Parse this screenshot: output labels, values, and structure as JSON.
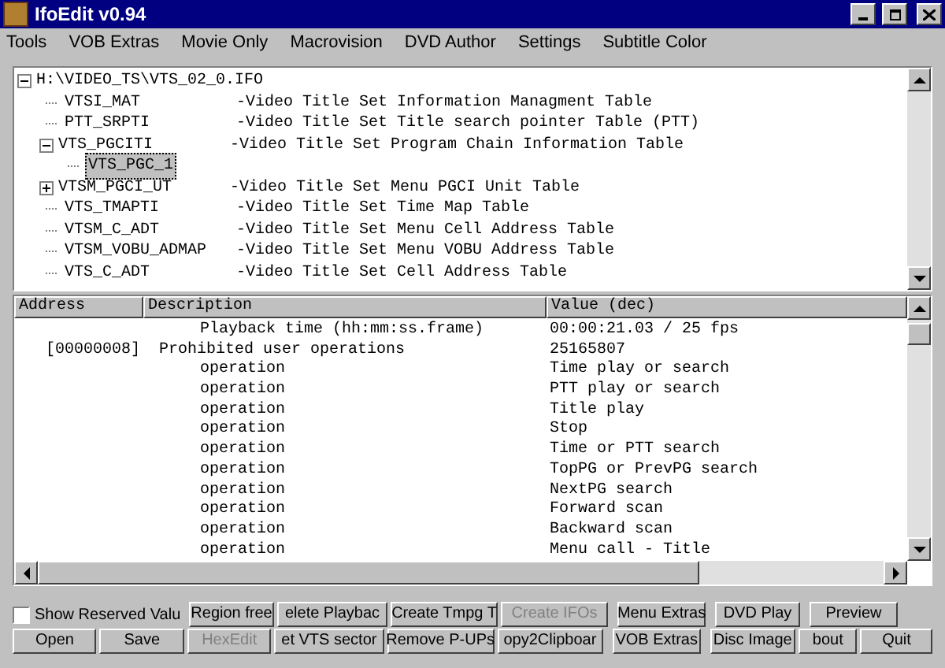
{
  "window": {
    "title": "IfoEdit v0.94"
  },
  "menu": [
    "Tools",
    "VOB Extras",
    "Movie Only",
    "Macrovision",
    "DVD Author",
    "Settings",
    "Subtitle Color"
  ],
  "tree": {
    "name": "H:\\VIDEO_TS\\VTS_02_0.IFO",
    "expanded": true,
    "selected": false,
    "children": [
      {
        "name": "VTSI_MAT",
        "description": "-Video Title Set Information Managment Table",
        "selected": false
      },
      {
        "name": "PTT_SRPTI",
        "description": "-Video Title Set Title search pointer Table (PTT)",
        "selected": false
      },
      {
        "name": "VTS_PGCITI",
        "description": "-Video Title Set Program Chain Information Table",
        "expanded": true,
        "selected": false,
        "children": [
          {
            "name": "VTS_PGC_1",
            "selected": true
          }
        ]
      },
      {
        "name": "VTSM_PGCI_UT",
        "description": "-Video Title Set Menu PGCI Unit Table",
        "expanded": false,
        "selected": false
      },
      {
        "name": "VTS_TMAPTI",
        "description": "-Video Title Set Time Map Table",
        "selected": false
      },
      {
        "name": "VTSM_C_ADT",
        "description": "-Video Title Set Menu Cell Address Table",
        "selected": false
      },
      {
        "name": "VTSM_VOBU_ADMAP",
        "description": "-Video Title Set Menu VOBU Address Table",
        "selected": false
      },
      {
        "name": "VTS_C_ADT",
        "description": "-Video Title Set Cell Address Table",
        "selected": false
      }
    ]
  },
  "table": {
    "columns": [
      "Address",
      "Description",
      "Value (dec)"
    ],
    "rows": [
      {
        "kind": "detail",
        "description": "Playback time (hh:mm:ss.frame)",
        "value": "00:00:21.03 / 25 fps"
      },
      {
        "kind": "entry",
        "address": "[00000008]",
        "description": "Prohibited user operations",
        "value": "25165807"
      },
      {
        "kind": "detail",
        "description": "operation",
        "value": "Time play or search"
      },
      {
        "kind": "detail",
        "description": "operation",
        "value": "PTT play or search"
      },
      {
        "kind": "detail",
        "description": "operation",
        "value": "Title play"
      },
      {
        "kind": "detail",
        "description": "operation",
        "value": "Stop"
      },
      {
        "kind": "detail",
        "description": "operation",
        "value": "Time or PTT search"
      },
      {
        "kind": "detail",
        "description": "operation",
        "value": "TopPG or PrevPG search"
      },
      {
        "kind": "detail",
        "description": "operation",
        "value": "NextPG search"
      },
      {
        "kind": "detail",
        "description": "operation",
        "value": "Forward scan"
      },
      {
        "kind": "detail",
        "description": "operation",
        "value": "Backward scan"
      },
      {
        "kind": "detail",
        "description": "operation",
        "value": "Menu call - Title"
      }
    ]
  },
  "show_reserved": {
    "label": "Show Reserved Valu",
    "checked": false
  },
  "buttons_row_1": [
    {
      "label": "Region free",
      "disabled": false
    },
    {
      "label": "elete Playbac",
      "disabled": false
    },
    {
      "label": "Create Tmpg T",
      "disabled": false
    },
    {
      "label": "Create IFOs",
      "disabled": true
    },
    {
      "label": "Menu Extras",
      "disabled": false
    },
    {
      "label": "DVD Play",
      "disabled": false
    },
    {
      "label": "Preview",
      "disabled": false
    }
  ],
  "buttons_row_2": [
    {
      "label": "Open",
      "disabled": false
    },
    {
      "label": "Save",
      "disabled": false
    },
    {
      "label": "HexEdit",
      "disabled": true
    },
    {
      "label": "et VTS sector",
      "disabled": false
    },
    {
      "label": "Remove P-UPs",
      "disabled": false
    },
    {
      "label": "opy2Clipboar",
      "disabled": false
    },
    {
      "label": "VOB Extras",
      "disabled": false
    },
    {
      "label": "Disc Image",
      "disabled": false
    },
    {
      "label": "bout",
      "disabled": false
    },
    {
      "label": "Quit",
      "disabled": false
    }
  ]
}
